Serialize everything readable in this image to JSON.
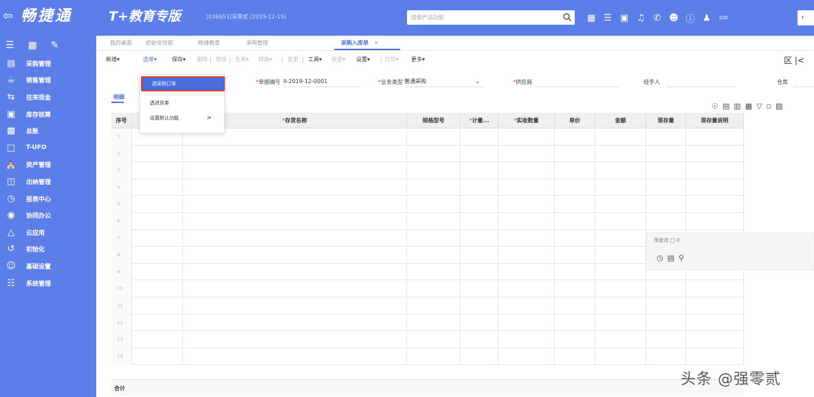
{
  "header": {
    "back_icon": "back-arrow-icon",
    "brand": "畅捷通",
    "product": "T+教育专版",
    "account_info": "[036653]深零贰 (2019-12-15)",
    "search_placeholder": "搜索产品功能",
    "icons": [
      "search-icon",
      "calculator-icon",
      "org-icon",
      "message-icon",
      "bell-icon",
      "phone-icon",
      "mascot-icon",
      "help-icon",
      "user-icon",
      "badge-icon"
    ],
    "badge_text": "100",
    "user_chip": "r"
  },
  "sidebar": {
    "top_icons": [
      "menu-icon",
      "bookmark-icon",
      "edit-icon"
    ],
    "items": [
      {
        "label": "采购管理",
        "icon": "cart-icon"
      },
      {
        "label": "销售管理",
        "icon": "sales-icon"
      },
      {
        "label": "往来现金",
        "icon": "cash-icon"
      },
      {
        "label": "库存核算",
        "icon": "warehouse-icon"
      },
      {
        "label": "总账",
        "icon": "ledger-icon"
      },
      {
        "label": "T-UFO",
        "icon": "report-icon"
      },
      {
        "label": "资产管理",
        "icon": "bank-icon"
      },
      {
        "label": "出纳管理",
        "icon": "cashier-icon"
      },
      {
        "label": "报表中心",
        "icon": "chart-icon"
      },
      {
        "label": "协同办公",
        "icon": "collab-icon"
      },
      {
        "label": "云应用",
        "icon": "cloud-icon"
      },
      {
        "label": "初始化",
        "icon": "init-icon"
      },
      {
        "label": "基础设置",
        "icon": "settings-user-icon"
      },
      {
        "label": "系统管理",
        "icon": "system-icon"
      }
    ]
  },
  "tabs": [
    {
      "label": "我的桌面"
    },
    {
      "label": "初始化导航"
    },
    {
      "label": "畅捷教育"
    },
    {
      "label": "采购管理"
    },
    {
      "label": "采购入库单",
      "active": true
    }
  ],
  "toolbar": {
    "items": [
      {
        "label": "新增▾"
      },
      {
        "label": "选单▾",
        "style": "link"
      },
      {
        "label": "保存▾"
      },
      {
        "label": "删除",
        "style": "dim"
      },
      {
        "label": "审核",
        "style": "dim"
      },
      {
        "label": "生单▾",
        "style": "dim"
      },
      {
        "label": "转换▾",
        "style": "dim"
      },
      {
        "label": "变更",
        "style": "dim"
      },
      {
        "label": "工具▾"
      },
      {
        "label": "联查▾",
        "style": "dim"
      },
      {
        "label": "设置▾"
      },
      {
        "label": "打印▾",
        "style": "dim"
      },
      {
        "label": "更多▾"
      }
    ],
    "right_icons": "区 |<"
  },
  "form": {
    "doc_no_label": "单据编号",
    "doc_no_value": "II-2019-12-0001",
    "biz_type_label": "业务类型",
    "biz_type_value": "普通采购",
    "supplier_label": "供应商",
    "handler_label": "经手人",
    "warehouse_label": "仓库"
  },
  "subtab": "明细",
  "dropdown": {
    "items": [
      "选采购订单",
      "选进货单",
      "设置默认功能"
    ]
  },
  "table": {
    "columns": [
      {
        "label": "序号"
      },
      {
        "label": ""
      },
      {
        "label": "存货名称",
        "required": true
      },
      {
        "label": "规格型号"
      },
      {
        "label": "计量...",
        "required": true
      },
      {
        "label": "实收数量",
        "required": true
      },
      {
        "label": "单价"
      },
      {
        "label": "金额"
      },
      {
        "label": "现存量"
      },
      {
        "label": "现存量说明"
      }
    ],
    "rows": [
      "1",
      "2",
      "3",
      "4",
      "5",
      "6",
      "7",
      "8",
      "9",
      "10",
      "11",
      "12",
      "13",
      "14"
    ],
    "total_label": "合计"
  },
  "float_panel": {
    "label": "现金流 ◯ 0"
  },
  "watermark": "头条 @强零贰"
}
